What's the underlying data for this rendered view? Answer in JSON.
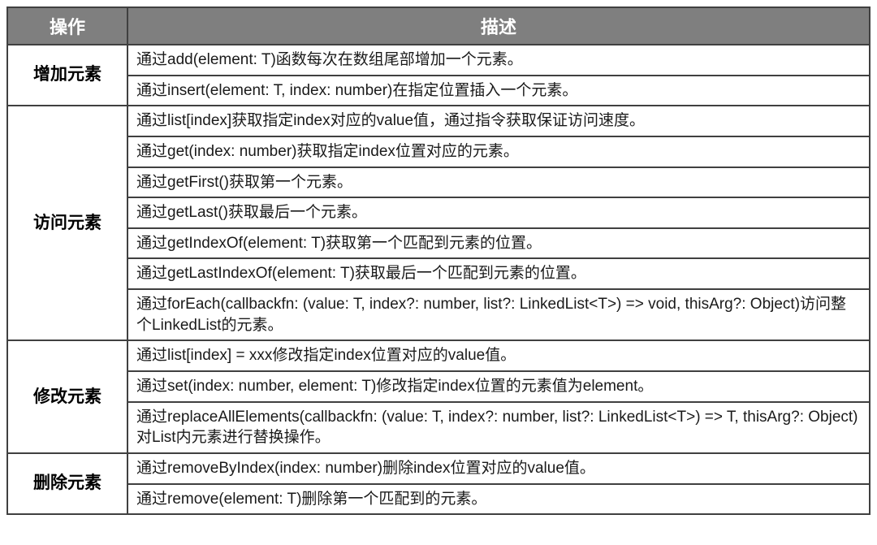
{
  "headers": {
    "operation": "操作",
    "description": "描述"
  },
  "sections": [
    {
      "op": "增加元素",
      "rows": [
        "通过add(element: T)函数每次在数组尾部增加一个元素。",
        "通过insert(element: T, index: number)在指定位置插入一个元素。"
      ]
    },
    {
      "op": "访问元素",
      "rows": [
        "通过list[index]获取指定index对应的value值，通过指令获取保证访问速度。",
        "通过get(index: number)获取指定index位置对应的元素。",
        "通过getFirst()获取第一个元素。",
        "通过getLast()获取最后一个元素。",
        "通过getIndexOf(element: T)获取第一个匹配到元素的位置。",
        "通过getLastIndexOf(element: T)获取最后一个匹配到元素的位置。",
        "通过forEach(callbackfn: (value: T, index?: number, list?: LinkedList<T>) => void, thisArg?: Object)访问整个LinkedList的元素。"
      ]
    },
    {
      "op": "修改元素",
      "rows": [
        "通过list[index] = xxx修改指定index位置对应的value值。",
        "通过set(index: number, element: T)修改指定index位置的元素值为element。",
        "通过replaceAllElements(callbackfn: (value: T, index?: number, list?: LinkedList<T>) => T, thisArg?: Object)对List内元素进行替换操作。"
      ]
    },
    {
      "op": "删除元素",
      "rows": [
        "通过removeByIndex(index: number)删除index位置对应的value值。",
        "通过remove(element: T)删除第一个匹配到的元素。"
      ]
    }
  ]
}
